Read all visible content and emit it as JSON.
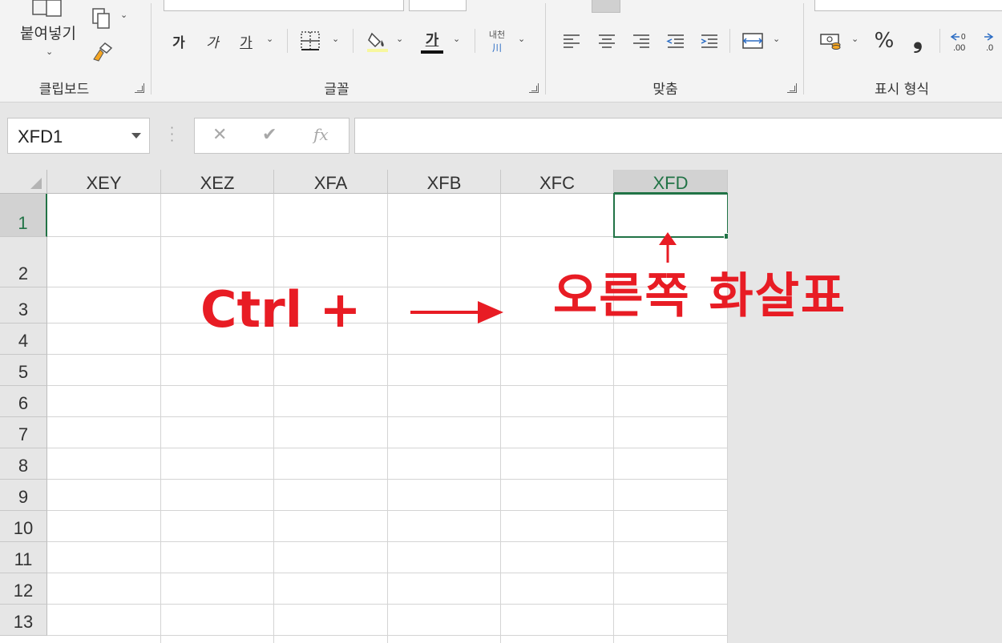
{
  "ribbon": {
    "clipboard": {
      "paste_label": "붙여넣기",
      "group_label": "클립보드"
    },
    "font": {
      "bold_label": "가",
      "italic_label": "가",
      "underline_label": "가",
      "font_color_label": "가",
      "phonetic_label": "내천",
      "group_label": "글꼴"
    },
    "alignment": {
      "group_label": "맞춤"
    },
    "number": {
      "percent_label": "%",
      "comma_label": "❟",
      "group_label": "표시 형식"
    }
  },
  "formula_bar": {
    "name_box": "XFD1",
    "cancel": "✕",
    "enter": "✔",
    "fx": "fx",
    "formula": ""
  },
  "sheet": {
    "columns": [
      "XEY",
      "XEZ",
      "XFA",
      "XFB",
      "XFC",
      "XFD"
    ],
    "rows": [
      "1",
      "2",
      "3",
      "4",
      "5",
      "6",
      "7",
      "8",
      "9",
      "10",
      "11",
      "12",
      "13"
    ],
    "selected_column": "XFD",
    "selected_row": "1",
    "grid_color": "#d4d4d4",
    "selection_color": "#217346"
  },
  "annotation": {
    "shortcut_text": "Ctrl +",
    "key_text": "오른쪽 화살표",
    "color": "#e81c24"
  }
}
